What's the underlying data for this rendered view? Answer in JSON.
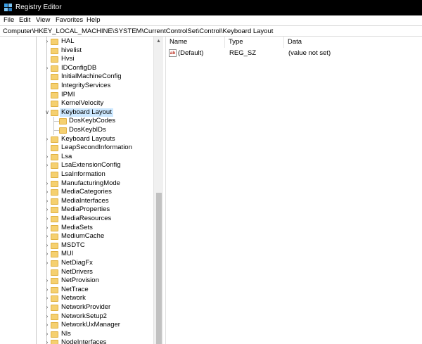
{
  "window": {
    "title": "Registry Editor"
  },
  "menu": [
    "File",
    "Edit",
    "View",
    "Favorites",
    "Help"
  ],
  "address": "Computer\\HKEY_LOCAL_MACHINE\\SYSTEM\\CurrentControlSet\\Control\\Keyboard Layout",
  "tree": [
    {
      "label": "HAL",
      "level": 0,
      "expander": "collapsed"
    },
    {
      "label": "hivelist",
      "level": 0,
      "expander": "none"
    },
    {
      "label": "Hvsi",
      "level": 0,
      "expander": "none"
    },
    {
      "label": "IDConfigDB",
      "level": 0,
      "expander": "collapsed"
    },
    {
      "label": "InitialMachineConfig",
      "level": 0,
      "expander": "none"
    },
    {
      "label": "IntegrityServices",
      "level": 0,
      "expander": "none"
    },
    {
      "label": "IPMI",
      "level": 0,
      "expander": "none"
    },
    {
      "label": "KernelVelocity",
      "level": 0,
      "expander": "none"
    },
    {
      "label": "Keyboard Layout",
      "level": 0,
      "expander": "expanded",
      "selected": true
    },
    {
      "label": "DosKeybCodes",
      "level": 1,
      "expander": "none"
    },
    {
      "label": "DosKeybIDs",
      "level": 1,
      "expander": "none"
    },
    {
      "label": "Keyboard Layouts",
      "level": 0,
      "expander": "collapsed"
    },
    {
      "label": "LeapSecondInformation",
      "level": 0,
      "expander": "none"
    },
    {
      "label": "Lsa",
      "level": 0,
      "expander": "collapsed"
    },
    {
      "label": "LsaExtensionConfig",
      "level": 0,
      "expander": "collapsed"
    },
    {
      "label": "LsaInformation",
      "level": 0,
      "expander": "none"
    },
    {
      "label": "ManufacturingMode",
      "level": 0,
      "expander": "collapsed"
    },
    {
      "label": "MediaCategories",
      "level": 0,
      "expander": "collapsed"
    },
    {
      "label": "MediaInterfaces",
      "level": 0,
      "expander": "collapsed"
    },
    {
      "label": "MediaProperties",
      "level": 0,
      "expander": "collapsed"
    },
    {
      "label": "MediaResources",
      "level": 0,
      "expander": "collapsed"
    },
    {
      "label": "MediaSets",
      "level": 0,
      "expander": "collapsed"
    },
    {
      "label": "MediumCache",
      "level": 0,
      "expander": "collapsed"
    },
    {
      "label": "MSDTC",
      "level": 0,
      "expander": "collapsed"
    },
    {
      "label": "MUI",
      "level": 0,
      "expander": "collapsed"
    },
    {
      "label": "NetDiagFx",
      "level": 0,
      "expander": "collapsed"
    },
    {
      "label": "NetDrivers",
      "level": 0,
      "expander": "none"
    },
    {
      "label": "NetProvision",
      "level": 0,
      "expander": "collapsed"
    },
    {
      "label": "NetTrace",
      "level": 0,
      "expander": "collapsed"
    },
    {
      "label": "Network",
      "level": 0,
      "expander": "collapsed"
    },
    {
      "label": "NetworkProvider",
      "level": 0,
      "expander": "collapsed"
    },
    {
      "label": "NetworkSetup2",
      "level": 0,
      "expander": "collapsed"
    },
    {
      "label": "NetworkUxManager",
      "level": 0,
      "expander": "collapsed"
    },
    {
      "label": "Nls",
      "level": 0,
      "expander": "collapsed"
    },
    {
      "label": "NodeInterfaces",
      "level": 0,
      "expander": "collapsed"
    }
  ],
  "list": {
    "columns": [
      "Name",
      "Type",
      "Data"
    ],
    "rows": [
      {
        "name": "(Default)",
        "type": "REG_SZ",
        "data": "(value not set)",
        "icon": "ab"
      }
    ]
  },
  "colors": {
    "titlebar": "#000000",
    "selection": "#cce8ff",
    "folder": "#f5d070"
  }
}
